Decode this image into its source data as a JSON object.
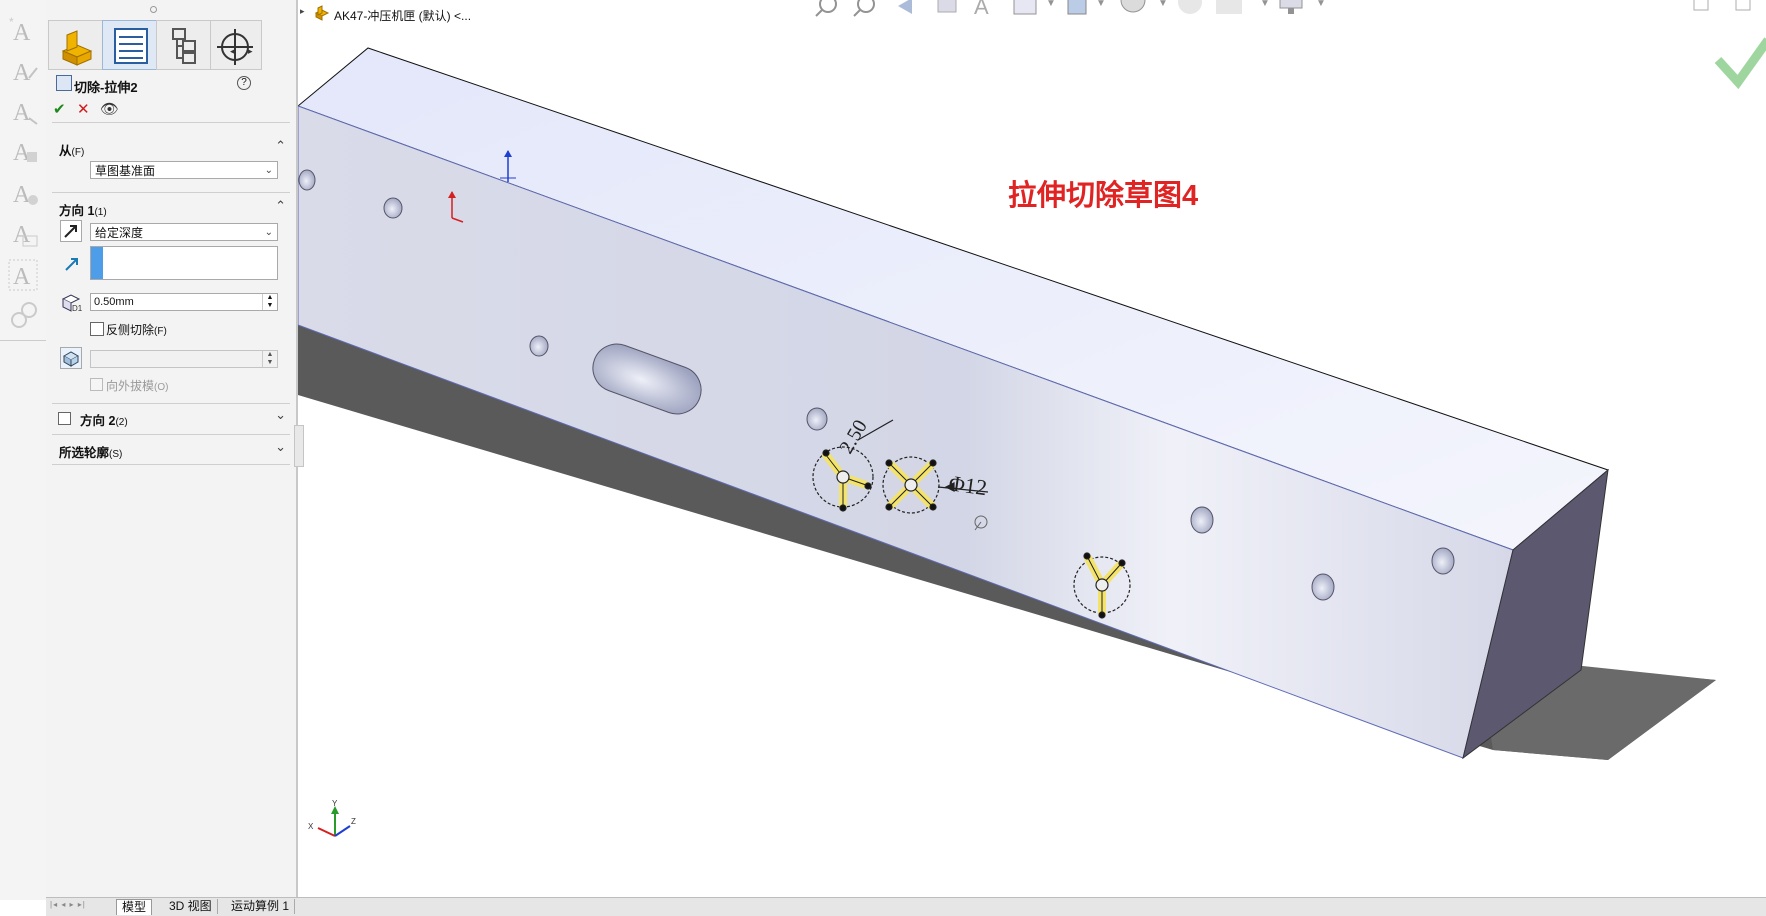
{
  "feature_manager": {
    "title": "切除-拉伸2",
    "tabs": [
      "feature-tab",
      "property-tab",
      "config-tab",
      "display-tab"
    ]
  },
  "from_group": {
    "title": "从",
    "shortcut": "(F)",
    "select_value": "草图基准面"
  },
  "direction1": {
    "title": "方向 1",
    "shortcut": "(1)",
    "end_condition": "给定深度",
    "depth_value": "0.50mm",
    "flip_label": "反侧切除",
    "flip_shortcut": "(F)",
    "draft_label": "向外拔模",
    "draft_shortcut": "(O)"
  },
  "direction2": {
    "title": "方向 2",
    "shortcut": "(2)"
  },
  "profiles": {
    "title": "所选轮廓",
    "shortcut": "(S)"
  },
  "document": {
    "title": "AK47-冲压机匣 (默认) <..."
  },
  "viewport": {
    "annotation": "拉伸切除草图4",
    "dim1": "2.50",
    "dim2": "Φ12",
    "triad": {
      "x": "X",
      "y": "Y",
      "z": "Z"
    }
  },
  "bottom_tabs": [
    "模型",
    "3D 视图",
    "运动算例 1"
  ],
  "colors": {
    "annotation": "#e02424",
    "body_top": "#e9ecfb",
    "body_front": "#d7dae8",
    "body_side": "#5b5870"
  }
}
